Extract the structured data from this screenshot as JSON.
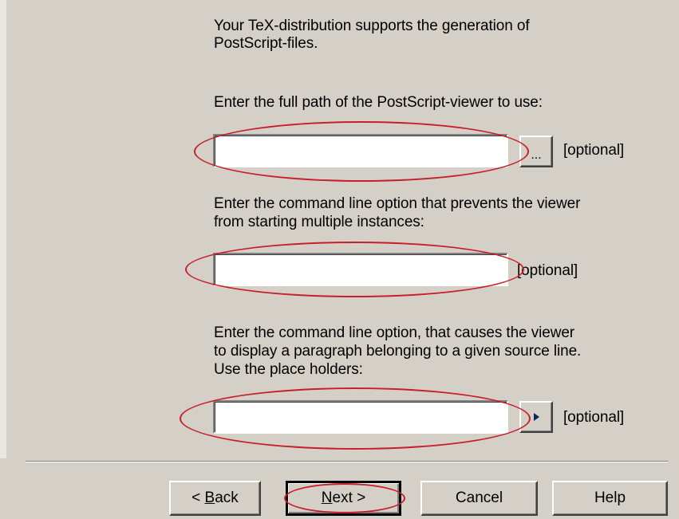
{
  "intro": {
    "line1": "Your TeX-distribution supports the generation of",
    "line2": "PostScript-files."
  },
  "viewer_path": {
    "label": "Enter the full path of the PostScript-viewer to use:",
    "value": "",
    "browse_label": "...",
    "optional_label": "[optional]"
  },
  "single_instance": {
    "label_line1": "Enter the command line option that prevents the viewer",
    "label_line2": "from starting multiple instances:",
    "value": "",
    "optional_label": "[optional]"
  },
  "source_line": {
    "label_line1": "Enter the command line option, that causes the viewer",
    "label_line2": "to display a paragraph belonging to a given source line.",
    "label_line3": "Use the place holders:",
    "value": "",
    "arrow_icon": "right-triangle-icon",
    "optional_label": "[optional]"
  },
  "footer": {
    "back_prefix": "< ",
    "back_key": "B",
    "back_rest": "ack",
    "next_key": "N",
    "next_rest": "ext >",
    "cancel_label": "Cancel",
    "help_label": "Help"
  },
  "colors": {
    "dialog_bg": "#d4d0c8",
    "annotation_red": "#c81e2a",
    "arrow_blue": "#0a246a"
  }
}
